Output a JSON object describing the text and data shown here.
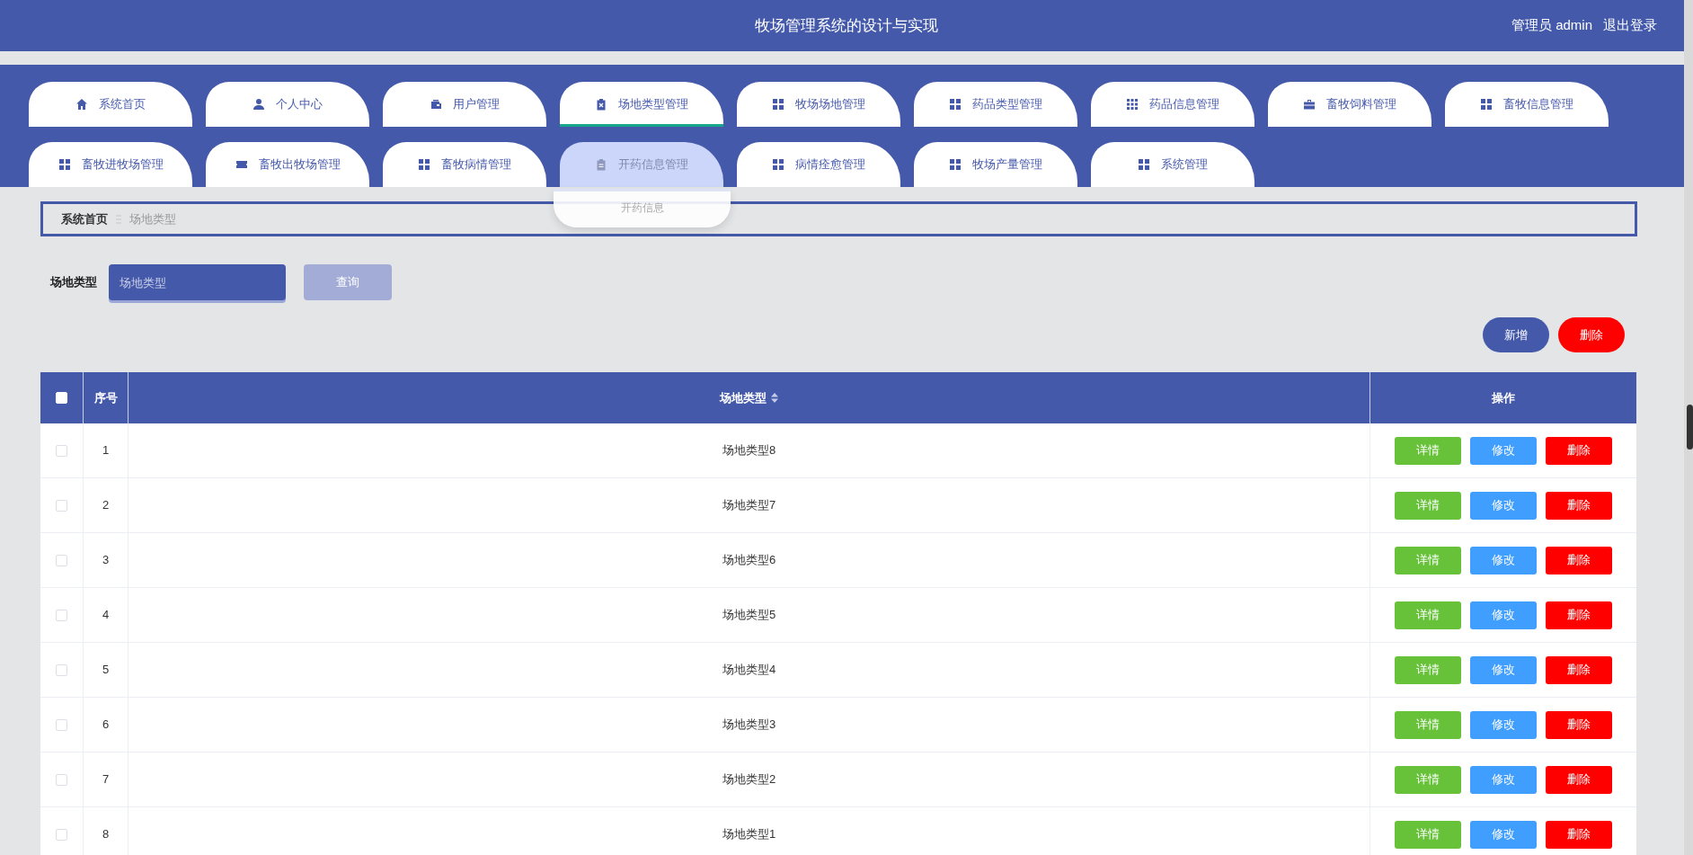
{
  "header": {
    "title": "牧场管理系统的设计与实现",
    "user": "管理员 admin",
    "logout": "退出登录"
  },
  "nav": {
    "tabs": [
      {
        "label": "系统首页",
        "selected": false,
        "hovered": false
      },
      {
        "label": "个人中心",
        "selected": false,
        "hovered": false
      },
      {
        "label": "用户管理",
        "selected": false,
        "hovered": false
      },
      {
        "label": "场地类型管理",
        "selected": true,
        "hovered": false
      },
      {
        "label": "牧场场地管理",
        "selected": false,
        "hovered": false
      },
      {
        "label": "药品类型管理",
        "selected": false,
        "hovered": false
      },
      {
        "label": "药品信息管理",
        "selected": false,
        "hovered": false
      },
      {
        "label": "畜牧饲料管理",
        "selected": false,
        "hovered": false
      },
      {
        "label": "畜牧信息管理",
        "selected": false,
        "hovered": false
      },
      {
        "label": "畜牧进牧场管理",
        "selected": false,
        "hovered": false
      },
      {
        "label": "畜牧出牧场管理",
        "selected": false,
        "hovered": false
      },
      {
        "label": "畜牧病情管理",
        "selected": false,
        "hovered": false
      },
      {
        "label": "开药信息管理",
        "selected": false,
        "hovered": true,
        "submenu": [
          "开药信息"
        ]
      },
      {
        "label": "病情痊愈管理",
        "selected": false,
        "hovered": false
      },
      {
        "label": "牧场产量管理",
        "selected": false,
        "hovered": false
      },
      {
        "label": "系统管理",
        "selected": false,
        "hovered": false
      }
    ]
  },
  "breadcrumb": [
    "系统首页",
    "场地类型"
  ],
  "search": {
    "label": "场地类型",
    "placeholder": "场地类型",
    "button": "查询"
  },
  "toolbar": [
    {
      "label": "新增",
      "kind": "add"
    },
    {
      "label": "删除",
      "kind": "delete"
    }
  ],
  "table": {
    "header_checked": false,
    "columns": [
      {
        "label": "序号",
        "sortable": false
      },
      {
        "label": "场地类型",
        "sortable": true
      },
      {
        "label": "操作",
        "sortable": false
      }
    ],
    "rows": [
      {
        "checked": false,
        "index": "1",
        "value": "场地类型8",
        "actions": [
          "详情",
          "修改",
          "删除"
        ]
      },
      {
        "checked": false,
        "index": "2",
        "value": "场地类型7",
        "actions": [
          "详情",
          "修改",
          "删除"
        ]
      },
      {
        "checked": false,
        "index": "3",
        "value": "场地类型6",
        "actions": [
          "详情",
          "修改",
          "删除"
        ]
      },
      {
        "checked": false,
        "index": "4",
        "value": "场地类型5",
        "actions": [
          "详情",
          "修改",
          "删除"
        ]
      },
      {
        "checked": false,
        "index": "5",
        "value": "场地类型4",
        "actions": [
          "详情",
          "修改",
          "删除"
        ]
      },
      {
        "checked": false,
        "index": "6",
        "value": "场地类型3",
        "actions": [
          "详情",
          "修改",
          "删除"
        ]
      },
      {
        "checked": false,
        "index": "7",
        "value": "场地类型2",
        "actions": [
          "详情",
          "修改",
          "删除"
        ]
      },
      {
        "checked": false,
        "index": "8",
        "value": "场地类型1",
        "actions": [
          "详情",
          "修改",
          "删除"
        ]
      }
    ]
  }
}
